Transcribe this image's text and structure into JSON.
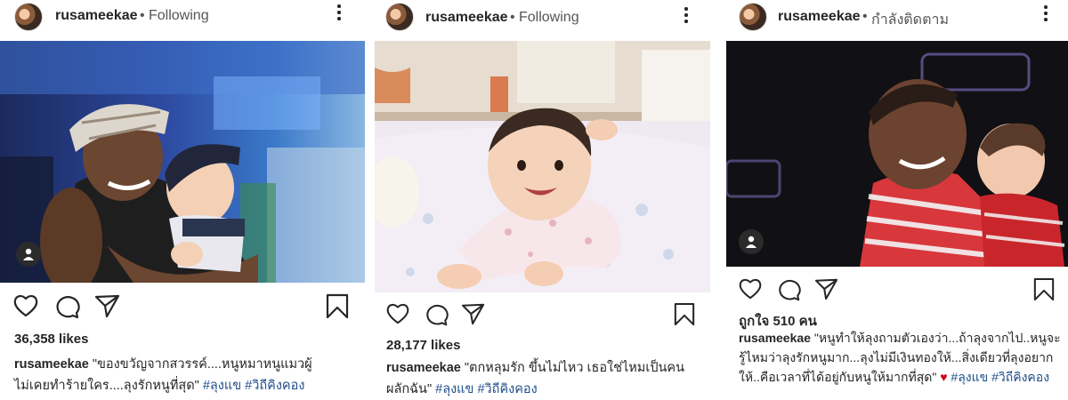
{
  "posts": [
    {
      "username": "rusameekae",
      "separator": "•",
      "follow_status": "Following",
      "likes": "36,358 likes",
      "caption_text": "\"ของขวัญจากสวรรค์....หนูหมาหนูแมวผู้ไม่เคยทำร้ายใคร....ลุงรักหนูที่สุด\"",
      "hashtags": [
        "#ลุงแข",
        "#วิถีคิงคอง"
      ]
    },
    {
      "username": "rusameekae",
      "separator": "•",
      "follow_status": "Following",
      "likes": "28,177 likes",
      "caption_text": "\"ตกหลุมรัก ขึ้นไม่ไหว เธอใช่ไหมเป็นคนผลักฉัน\"",
      "hashtags": [
        "#ลุงแข",
        "#วิถีคิงคอง"
      ]
    },
    {
      "username": "rusameekae",
      "separator": "•",
      "follow_status": "กำลังติดตาม",
      "likes": "ถูกใจ 510 คน",
      "caption_text": "\"หนูทำให้ลุงถามตัวเองว่า...ถ้าลุงจากไป..หนูจะรู้ไหมว่าลุงรักหนูมาก...ลุงไม่มีเงินทองให้...สิ่งเดียวที่ลุงอยากให้..คือเวลาที่ได้อยู่กับหนูให้มากที่สุด\"",
      "emoji": "♥",
      "hashtags": [
        "#ลุงแข",
        "#วิถีคิงคอง"
      ]
    }
  ],
  "icons": {
    "like": "heart-outline-icon",
    "comment": "comment-bubble-icon",
    "share": "paper-plane-icon",
    "save": "bookmark-icon",
    "more": "more-vertical-icon",
    "tagged": "user-tag-icon"
  },
  "colors": {
    "hashtag": "#1f4e8c",
    "heart_emoji": "#d0021b",
    "text": "#262626"
  }
}
